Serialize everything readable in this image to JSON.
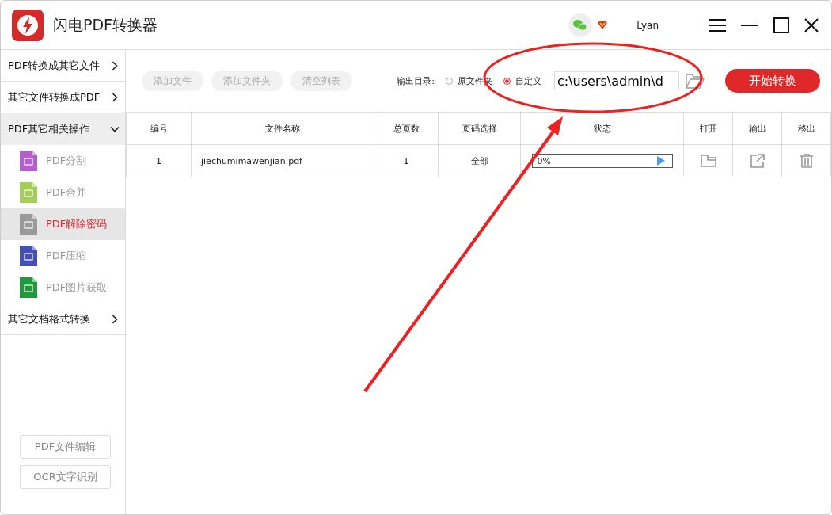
{
  "window": {
    "title": "闪电PDF转换器",
    "user": "Lyan"
  },
  "sidebar": {
    "groups": [
      {
        "label": "PDF转换成其它文件",
        "expanded": false
      },
      {
        "label": "其它文件转换成PDF",
        "expanded": false
      },
      {
        "label": "PDF其它相关操作",
        "expanded": true,
        "children": [
          {
            "label": "PDF分割",
            "selected": false,
            "color": "#b35fcf"
          },
          {
            "label": "PDF合并",
            "selected": false,
            "color": "#a6cc5a"
          },
          {
            "label": "PDF解除密码",
            "selected": true,
            "color": "#9a9a9a"
          },
          {
            "label": "PDF压缩",
            "selected": false,
            "color": "#4450b4"
          },
          {
            "label": "PDF图片获取",
            "selected": false,
            "color": "#1f9a3a"
          }
        ]
      },
      {
        "label": "其它文档格式转换",
        "expanded": false
      }
    ],
    "bottom_buttons": [
      "PDF文件编辑",
      "OCR文字识别"
    ]
  },
  "toolbar": {
    "buttons": [
      "添加文件",
      "添加文件夹",
      "清空列表"
    ],
    "output": {
      "label": "输出目录:",
      "options": [
        {
          "label": "原文件夹",
          "selected": false
        },
        {
          "label": "自定义",
          "selected": true
        }
      ],
      "path": "c:\\users\\admin\\d"
    },
    "start_button": "开始转换"
  },
  "table": {
    "columns": [
      "编号",
      "文件名称",
      "总页数",
      "页码选择",
      "状态",
      "打开",
      "输出",
      "移出"
    ],
    "rows": [
      {
        "number": "1",
        "name": "jiechumimawenjian.pdf",
        "pages": "1",
        "range": "全部",
        "status": "0%",
        "level": 0
      }
    ]
  }
}
